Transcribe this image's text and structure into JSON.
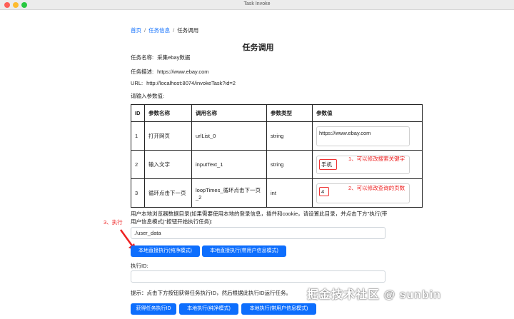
{
  "window": {
    "title": "Task Invoke"
  },
  "breadcrumb": {
    "home": "首页",
    "task_info": "任务信息",
    "current": "任务调用",
    "sep": "/"
  },
  "page_title": "任务调用",
  "info": {
    "name_label": "任务名称:",
    "name_value": "采集ebay数据",
    "desc_label": "任务描述:",
    "desc_value": "https://www.ebay.com",
    "url_label": "URL:",
    "url_value": "http://localhost:8074/invokeTask?id=2",
    "prompt": "请输入参数值:"
  },
  "table": {
    "headers": [
      "ID",
      "参数名称",
      "调用名称",
      "参数类型",
      "参数值"
    ],
    "rows": [
      {
        "id": "1",
        "name": "打开网页",
        "call": "urlList_0",
        "type": "string",
        "value": "https://www.ebay.com"
      },
      {
        "id": "2",
        "name": "输入文字",
        "call": "inputText_1",
        "type": "string",
        "value": "手机"
      },
      {
        "id": "3",
        "name": "循环点击下一页",
        "call": "loopTimes_循环点击下一页_2",
        "type": "int",
        "value": "4"
      }
    ]
  },
  "annotations": {
    "a1": "1、可以修改搜索关键字",
    "a2": "2、可以修改查询的页数",
    "a3": "3、执行"
  },
  "browser_dir": {
    "description": "用户本地浏览器数据目录(如果需要使用本地的登录信息，插件和cookie，请设置此目录，并点击下方\"执行(带用户信息模式)\"按钮开始执行任务):",
    "value": "./user_data"
  },
  "buttons": {
    "direct_clean": "本地直接执行(纯净模式)",
    "direct_user": "本地直接执行(带用户信息模式)",
    "get_id": "获得任务执行ID",
    "exec_clean": "本地执行(纯净模式)",
    "exec_user": "本地执行(带用户信息模式)"
  },
  "exec_id": {
    "label": "执行ID:",
    "value": ""
  },
  "hint": "提示：点击下方按钮获得任务执行ID，然后根据此执行ID运行任务。",
  "watermark": "掘金技术社区 @ sunbin",
  "colors": {
    "primary": "#0d6efd",
    "annotation": "#e22222"
  }
}
